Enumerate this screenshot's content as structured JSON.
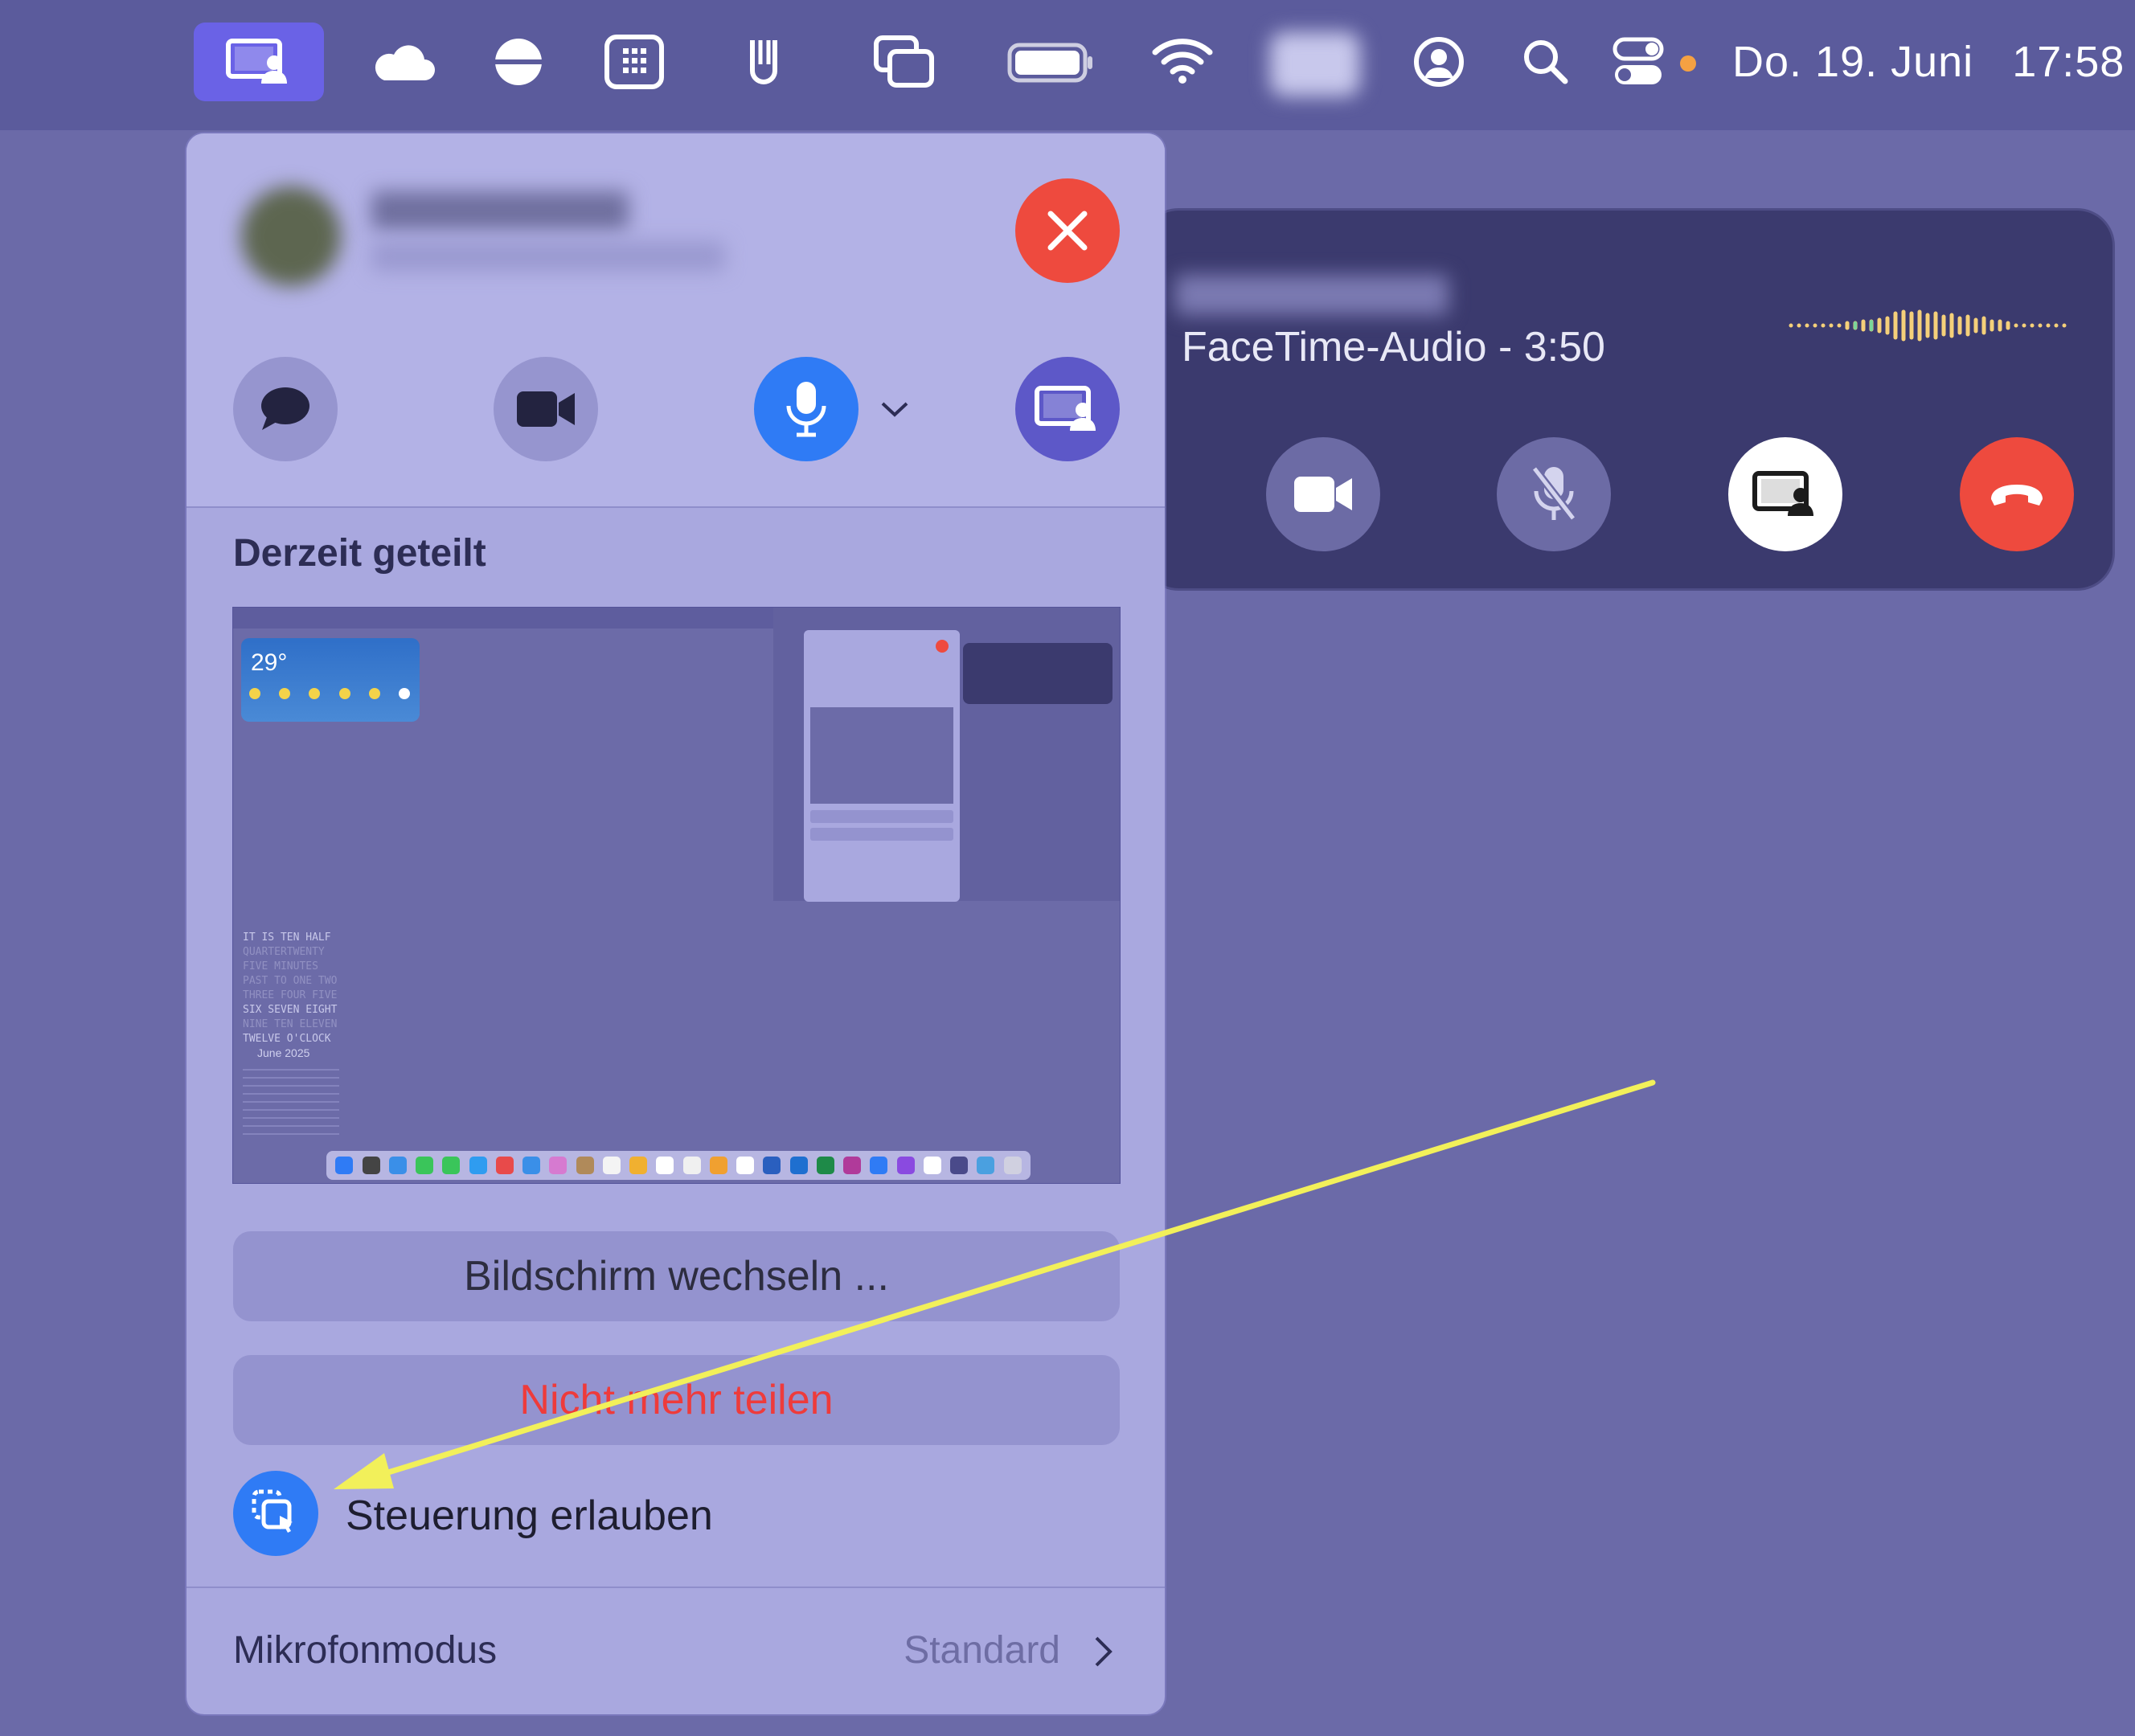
{
  "menubar": {
    "date": "Do. 19. Juni",
    "time": "17:58",
    "icons": [
      "screen-sharing-icon",
      "cloud-icon",
      "half-circle-icon",
      "grid-icon",
      "u-clip-icon",
      "windows-icon",
      "battery-icon",
      "wifi-icon",
      "blurred-icon",
      "user-circle-icon",
      "search-icon",
      "control-center-icon"
    ]
  },
  "panel": {
    "section_title": "Derzeit geteilt",
    "switch_screen_label": "Bildschirm wechseln ...",
    "stop_sharing_label": "Nicht mehr teilen",
    "allow_control_label": "Steuerung erlauben",
    "mic_mode_label": "Mikrofonmodus",
    "mic_mode_value": "Standard",
    "preview": {
      "weather_temp": "29°",
      "clock_text": [
        "IT IS TEN HALF",
        "QUARTERTWENTY",
        "FIVE MINUTES",
        "PAST TO ONE TWO",
        "THREE FOUR FIVE",
        "SIX SEVEN EIGHT",
        "NINE TEN ELEVEN",
        "TWELVE O'CLOCK"
      ],
      "calendar_label": "June 2025"
    }
  },
  "hud": {
    "status": "FaceTime-Audio - 3:50"
  },
  "colors": {
    "accent_blue": "#2f7bf5",
    "close_red": "#ee4a3e",
    "stop_red": "#ee3b3b",
    "share_purple": "#5d58c8",
    "arrow_yellow": "#f2f05a"
  }
}
